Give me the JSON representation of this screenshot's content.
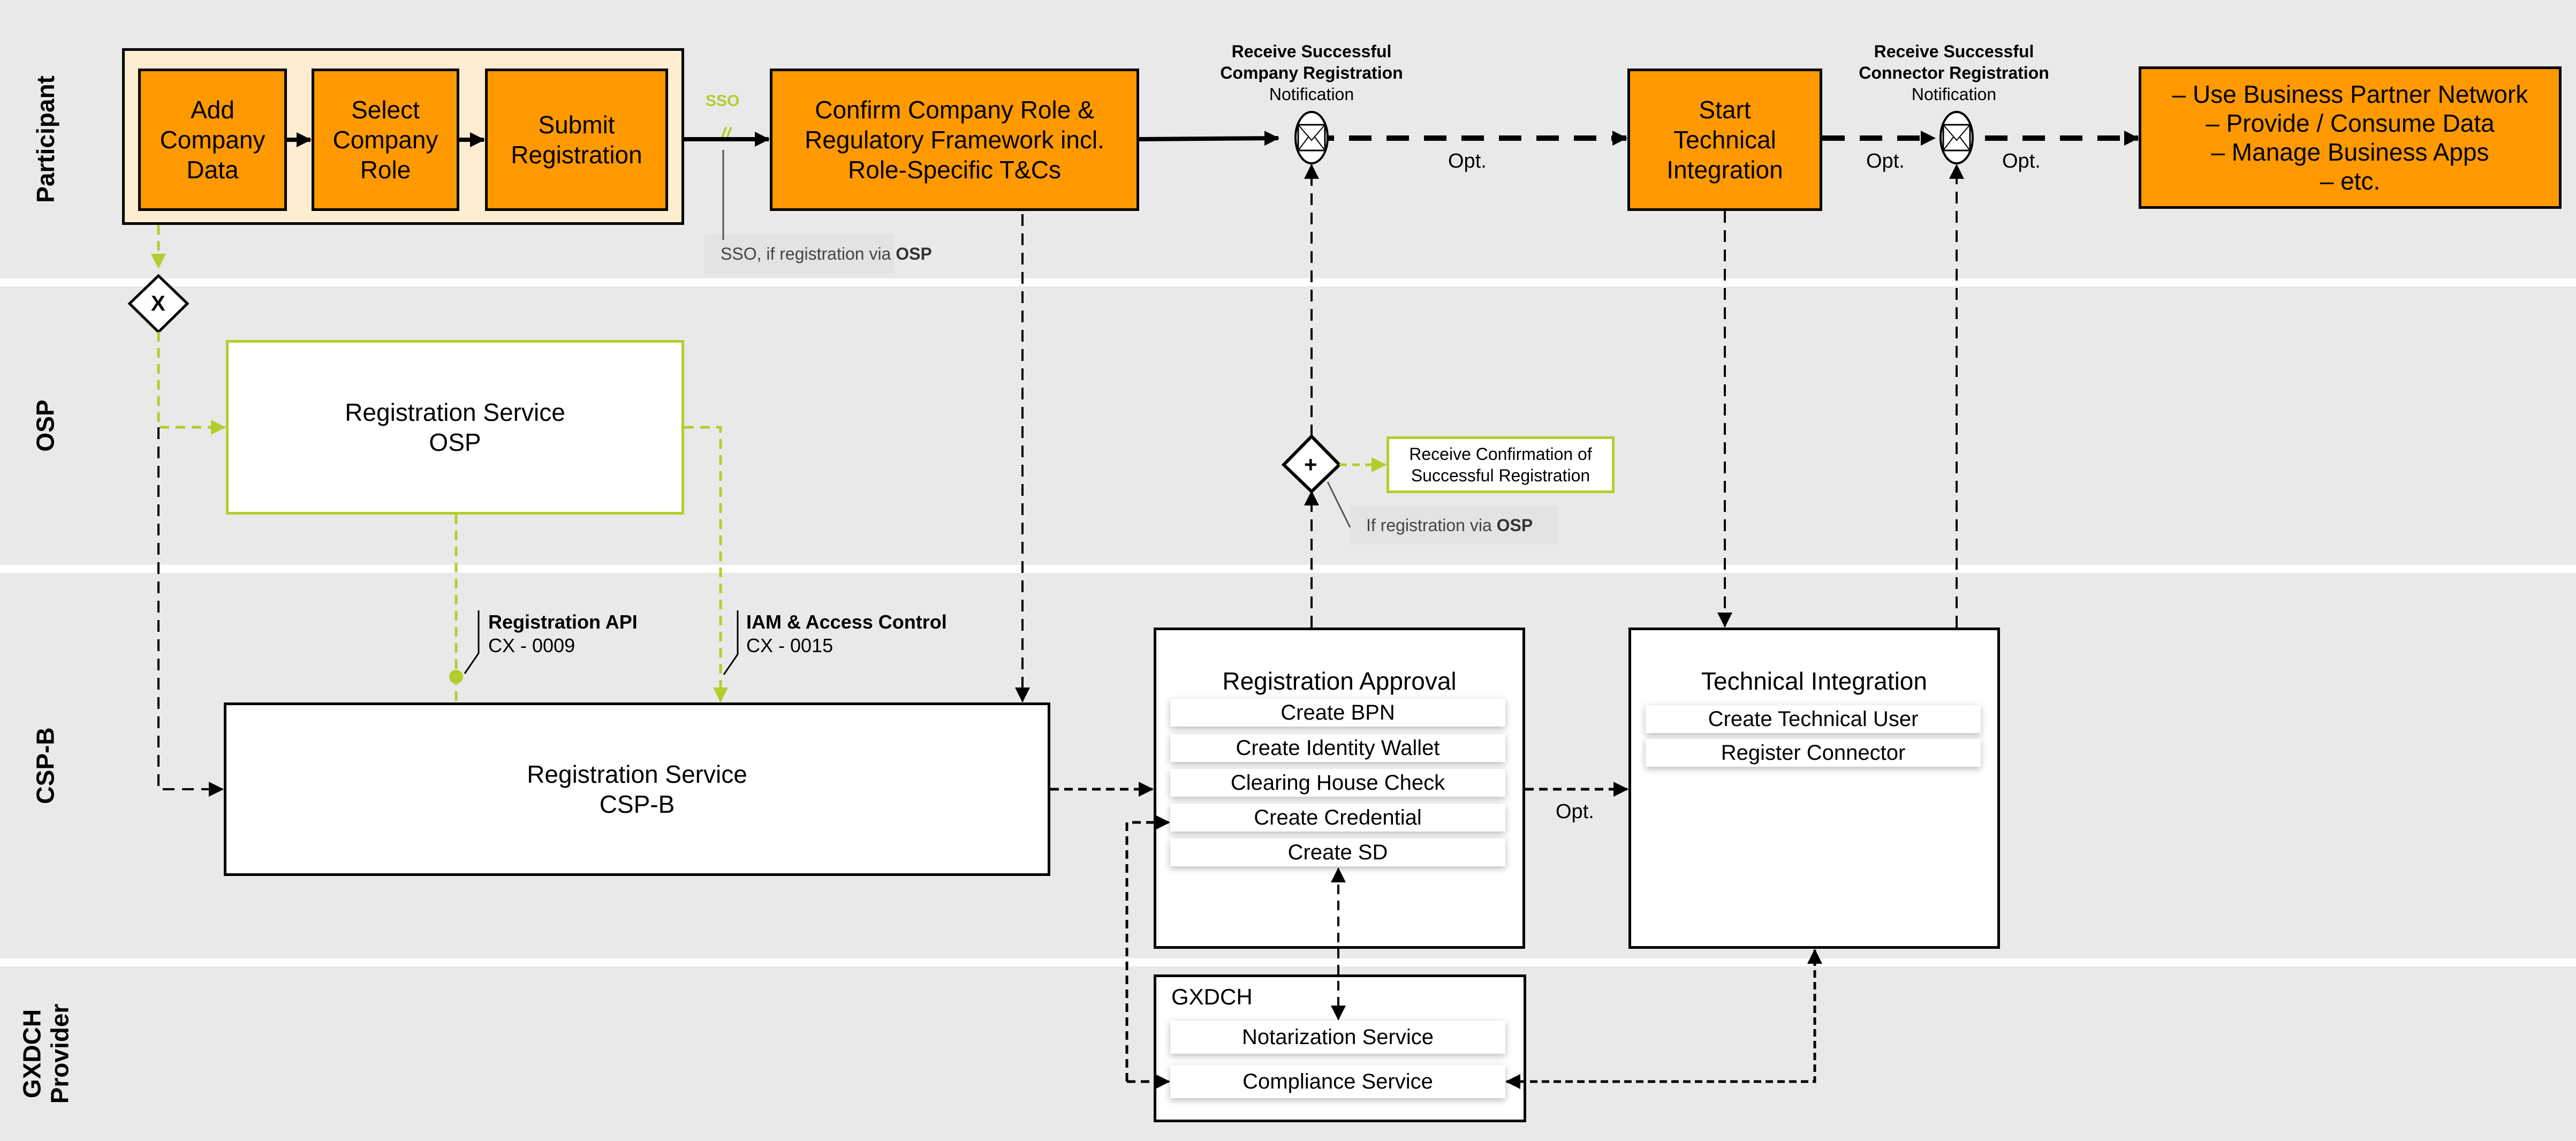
{
  "lanes": [
    {
      "id": "participant",
      "label": "Participant"
    },
    {
      "id": "osp",
      "label": "OSP"
    },
    {
      "id": "cspb",
      "label": "CSP-B"
    },
    {
      "id": "gxdch",
      "label": "GXDCH Provider"
    }
  ],
  "participant": {
    "steps": [
      {
        "label": "Add Company Data"
      },
      {
        "label": "Select Company Role"
      },
      {
        "label": "Submit Registration"
      }
    ],
    "sso_label": "SSO",
    "sso_mark": "//",
    "sso_note": {
      "text": "SSO, if registration via ",
      "bold": "OSP"
    },
    "confirm_step": "Confirm Company Role & Regulatory Framework incl. Role-Specific T&Cs",
    "event1": {
      "line1": "Receive Successful",
      "line2": "Company Registration",
      "line3": "Notification"
    },
    "start_technical": "Start Technical Integration",
    "event2": {
      "line1": "Receive Successful",
      "line2": "Connector Registration",
      "line3": "Notification"
    },
    "outcomes": [
      "–  Use Business Partner Network",
      "–  Provide / Consume Data",
      "–  Manage Business Apps",
      "–  etc."
    ],
    "opt_labels": [
      "Opt.",
      "Opt.",
      "Opt."
    ]
  },
  "gateways": {
    "exclusive_symbol": "X",
    "parallel_symbol": "+"
  },
  "osp": {
    "service_line1": "Registration Service",
    "service_line2": "OSP",
    "confirmation_box": "Receive Confirmation of Successful Registration",
    "note": {
      "text": "If registration via ",
      "bold": "OSP"
    }
  },
  "interfaces": [
    {
      "name": "Registration API",
      "code": "CX - 0009"
    },
    {
      "name": "IAM & Access Control",
      "code": "CX - 0015"
    }
  ],
  "cspb": {
    "service_line1": "Registration Service",
    "service_line2": "CSP-B",
    "approval": {
      "title": "Registration Approval",
      "items": [
        "Create BPN",
        "Create Identity Wallet",
        "Clearing House Check",
        "Create Credential",
        "Create SD"
      ]
    },
    "opt_label": "Opt.",
    "technical": {
      "title": "Technical Integration",
      "items": [
        "Create Technical User",
        "Register Connector"
      ]
    }
  },
  "gxdch": {
    "title": "GXDCH",
    "items": [
      "Notarization Service",
      "Compliance Service"
    ]
  },
  "colors": {
    "lane_bg": "#e9e9e9",
    "orange": "#ff9900",
    "group_bg": "#ffedd1",
    "green": "#b5cc2e",
    "note_bg": "#e3e3e3"
  }
}
